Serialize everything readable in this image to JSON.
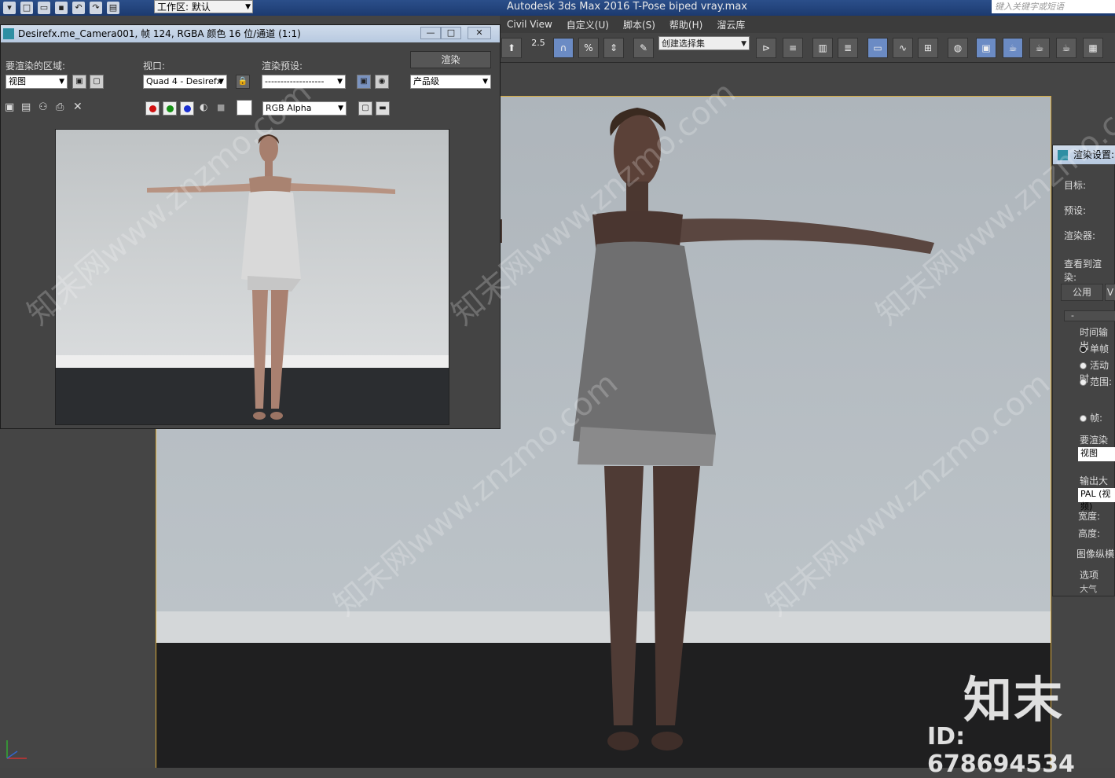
{
  "titlebar": {
    "workspace_label": "工作区: 默认",
    "app_title": "Autodesk 3ds Max 2016      T-Pose biped vray.max",
    "search_placeholder": "键入关键字或短语"
  },
  "menubar": {
    "items": [
      "Civil View",
      "自定义(U)",
      "脚本(S)",
      "帮助(H)",
      "溜云库"
    ]
  },
  "toolbar": {
    "snap_value": "2.5",
    "selection_set_placeholder": "创建选择集"
  },
  "render_window": {
    "title": "Desirefx.me_Camera001, 帧 124, RGBA 颜色 16 位/通道 (1:1)",
    "area_label": "要渲染的区域:",
    "area_value": "视图",
    "viewport_label": "视口:",
    "viewport_value": "Quad 4 - Desirefx",
    "preset_label": "渲染预设:",
    "preset_value": "-------------------",
    "render_button": "渲染",
    "production_value": "产品级",
    "channel_value": "RGB Alpha"
  },
  "render_settings": {
    "title": "渲染设置:",
    "target_label": "目标:",
    "preset_label": "预设:",
    "renderer_label": "渲染器:",
    "view_label": "查看到渲染:",
    "tab_common": "公用",
    "tab_v": "V",
    "collapse": "-",
    "time_output_label": "时间输出",
    "radio_single": "单帧",
    "radio_active": "活动时",
    "radio_range": "范围:",
    "radio_frames": "帧:",
    "render_area_label": "要渲染的",
    "render_area_value": "视图",
    "output_size_label": "输出大小",
    "output_size_value": "PAL (视频)",
    "width_label": "宽度:",
    "height_label": "高度:",
    "aspect_label": "图像纵横",
    "options_label": "选项",
    "atmos_label": "大气"
  },
  "brand": {
    "logo_text": "知末",
    "id_text": "ID: 678694534",
    "watermark_text": "知末网www.znzmo.com"
  }
}
